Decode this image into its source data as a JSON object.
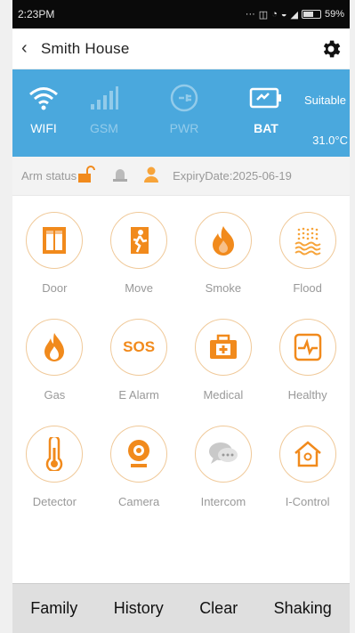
{
  "status_bar": {
    "time": "2:23PM",
    "battery": "59%",
    "battery_fraction": 0.59
  },
  "header": {
    "back_icon": "chevron-left",
    "title": "Smith House",
    "settings_icon": "gear"
  },
  "panel": {
    "items": [
      {
        "label": "WIFI",
        "icon": "wifi-icon",
        "active": true
      },
      {
        "label": "GSM",
        "icon": "signal-icon",
        "active": false
      },
      {
        "label": "PWR",
        "icon": "power-plug-icon",
        "active": false
      },
      {
        "label": "BAT",
        "icon": "battery-icon",
        "active": true
      }
    ],
    "suitable": "Suitable",
    "temperature": "31.0°C"
  },
  "arm": {
    "label": "Arm status",
    "expiry": "ExpiryDate:2025-06-19"
  },
  "devices": [
    {
      "label": "Door",
      "icon": "door-icon"
    },
    {
      "label": "Move",
      "icon": "running-person-icon"
    },
    {
      "label": "Smoke",
      "icon": "fire-icon"
    },
    {
      "label": "Flood",
      "icon": "flood-icon"
    },
    {
      "label": "Gas",
      "icon": "gas-flame-icon"
    },
    {
      "label": "E Alarm",
      "icon": "sos-icon",
      "text": "SOS"
    },
    {
      "label": "Medical",
      "icon": "medical-kit-icon"
    },
    {
      "label": "Healthy",
      "icon": "heartbeat-icon"
    },
    {
      "label": "Detector",
      "icon": "thermometer-icon"
    },
    {
      "label": "Camera",
      "icon": "camera-icon"
    },
    {
      "label": "Intercom",
      "icon": "chat-bubble-icon"
    },
    {
      "label": "I-Control",
      "icon": "home-icon"
    }
  ],
  "bottom_nav": [
    "Family",
    "History",
    "Clear",
    "Shaking"
  ],
  "colors": {
    "accent_blue": "#4aa8dd",
    "orange": "#f18a1c",
    "light_orange": "#f7c089"
  }
}
